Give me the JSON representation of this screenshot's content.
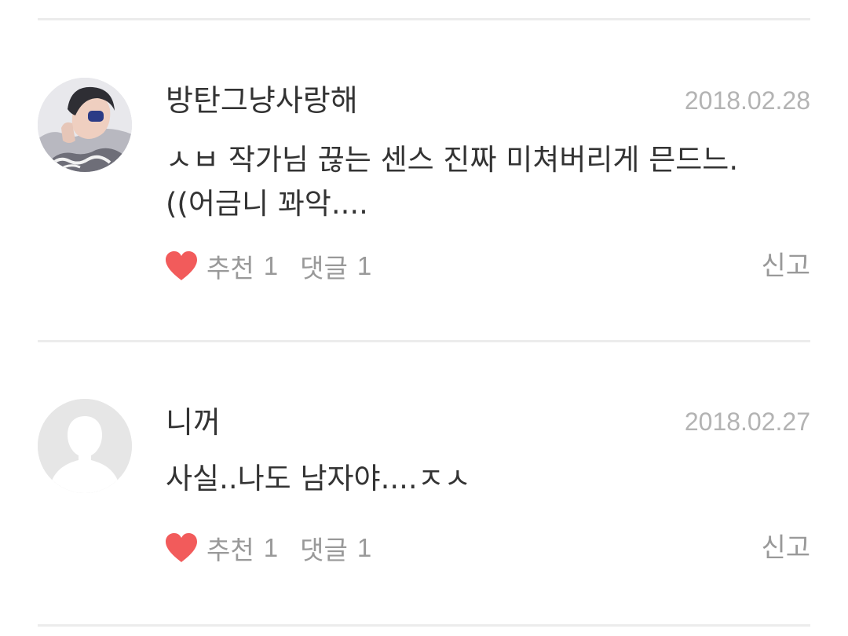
{
  "comments": [
    {
      "author": "방탄그냥사랑해",
      "date": "2018.02.28",
      "text": "ㅅㅂ 작가님 끊는 센스 진짜 미쳐버리게 믄드느. ((어금니 꽈악....",
      "like_label": "추천",
      "like_count": "1",
      "reply_label": "댓글",
      "reply_count": "1",
      "report_label": "신고",
      "avatar_icon": "user-photo"
    },
    {
      "author": "니꺼",
      "date": "2018.02.27",
      "text": "사실..나도 남자야....ㅈㅅ",
      "like_label": "추천",
      "like_count": "1",
      "reply_label": "댓글",
      "reply_count": "1",
      "report_label": "신고",
      "avatar_icon": "default-user-icon"
    }
  ],
  "colors": {
    "heart": "#f25b5b",
    "divider": "#ececec",
    "muted": "#999999",
    "date": "#b3b3b3",
    "text": "#333333"
  }
}
